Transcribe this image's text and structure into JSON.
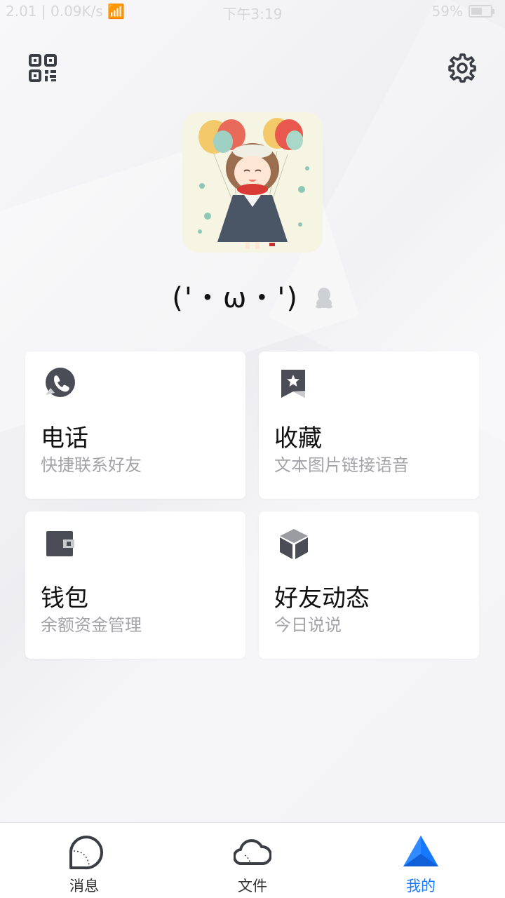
{
  "status_bar": {
    "left": "2.01 | 0.09K/s 📶",
    "time": "下午3:19",
    "battery_text": "59%",
    "battery_level": 0.59
  },
  "header": {
    "qr_icon": "qr-code-icon",
    "settings_icon": "gear-icon"
  },
  "profile": {
    "nickname": "('・ω・')",
    "badge_icon": "qq-penguin-icon"
  },
  "cards": [
    {
      "title": "电话",
      "subtitle": "快捷联系好友",
      "icon": "phone-icon"
    },
    {
      "title": "收藏",
      "subtitle": "文本图片链接语音",
      "icon": "bookmark-star-icon"
    },
    {
      "title": "钱包",
      "subtitle": "余额资金管理",
      "icon": "wallet-icon"
    },
    {
      "title": "好友动态",
      "subtitle": "今日说说",
      "icon": "cube-icon"
    }
  ],
  "tabbar": {
    "tabs": [
      {
        "label": "消息",
        "icon": "message-bubble-icon",
        "active": false
      },
      {
        "label": "文件",
        "icon": "cloud-icon",
        "active": false
      },
      {
        "label": "我的",
        "icon": "triangle-icon",
        "active": true
      }
    ],
    "active_color": "#1677ff"
  },
  "colors": {
    "icon_gray": "#4a4d55",
    "subtitle_gray": "#a4a4a8"
  }
}
